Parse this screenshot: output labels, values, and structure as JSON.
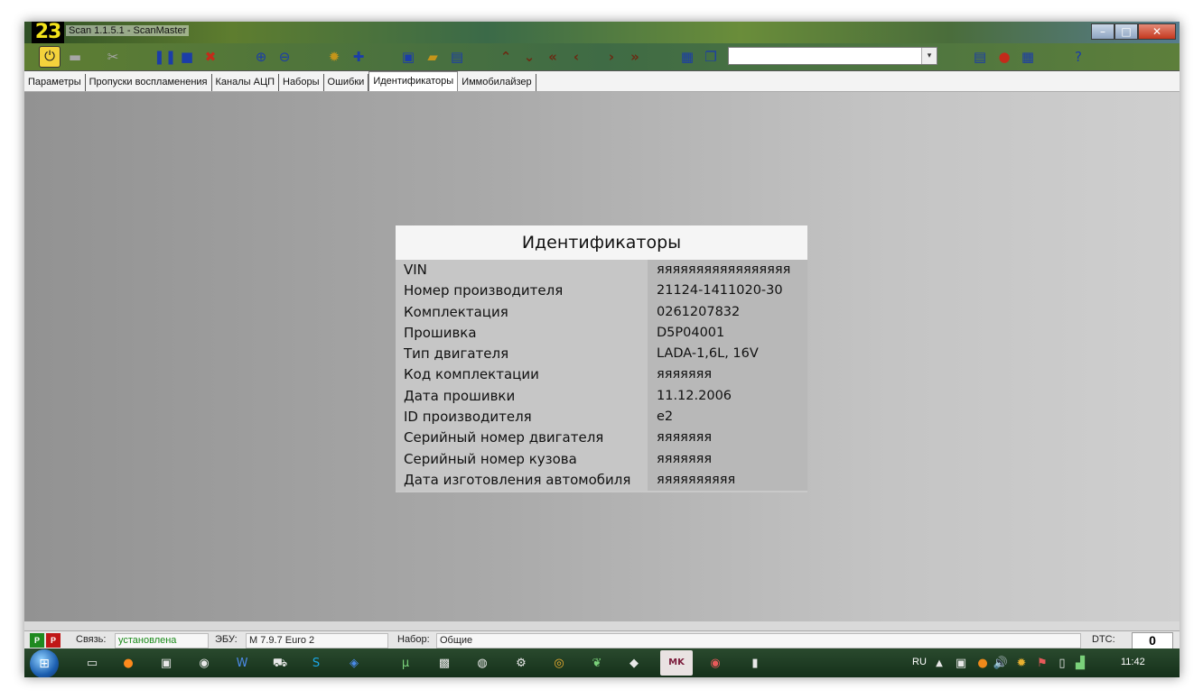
{
  "window": {
    "logo": "23",
    "title": "Scan 1.1.5.1 - ScanMaster",
    "controls": {
      "minimize": "–",
      "maximize": "□",
      "close": "✕"
    }
  },
  "toolbar": {
    "combo_value": "",
    "combo_arrow": "▾"
  },
  "tabs": [
    {
      "label": "Параметры"
    },
    {
      "label": "Пропуски воспламенения"
    },
    {
      "label": "Каналы АЦП"
    },
    {
      "label": "Наборы"
    },
    {
      "label": "Ошибки"
    },
    {
      "label": "Идентификаторы",
      "active": true
    },
    {
      "label": "Иммобилайзер"
    }
  ],
  "identifiers": {
    "title": "Идентификаторы",
    "rows": [
      {
        "label": "VIN",
        "value": "яяяяяяяяяяяяяяяяя"
      },
      {
        "label": "Номер производителя",
        "value": "21124-1411020-30"
      },
      {
        "label": "Комплектация",
        "value": "0261207832"
      },
      {
        "label": "Прошивка",
        "value": "D5P04001"
      },
      {
        "label": "Тип двигателя",
        "value": "LADA-1,6L, 16V"
      },
      {
        "label": "Код комплектации",
        "value": "яяяяяяя"
      },
      {
        "label": "Дата прошивки",
        "value": "11.12.2006"
      },
      {
        "label": "ID производителя",
        "value": "e2"
      },
      {
        "label": "Серийный номер двигателя",
        "value": "яяяяяяя"
      },
      {
        "label": "Серийный номер кузова",
        "value": "яяяяяяя"
      },
      {
        "label": "Дата изготовления автомобиля",
        "value": "яяяяяяяяяя"
      }
    ]
  },
  "statusbar": {
    "indicator1": "P",
    "indicator2": "P",
    "link_label": "Связь:",
    "link_value": "установлена",
    "link_color": "#1a8a1a",
    "ecu_label": "ЭБУ:",
    "ecu_value": "M 7.9.7 Euro 2",
    "set_label": "Набор:",
    "set_value": "Общие",
    "dtc_label": "DTC:",
    "dtc_value": "0"
  },
  "taskbar": {
    "lang": "RU",
    "clock": "11:42",
    "mk_label": "MK"
  }
}
